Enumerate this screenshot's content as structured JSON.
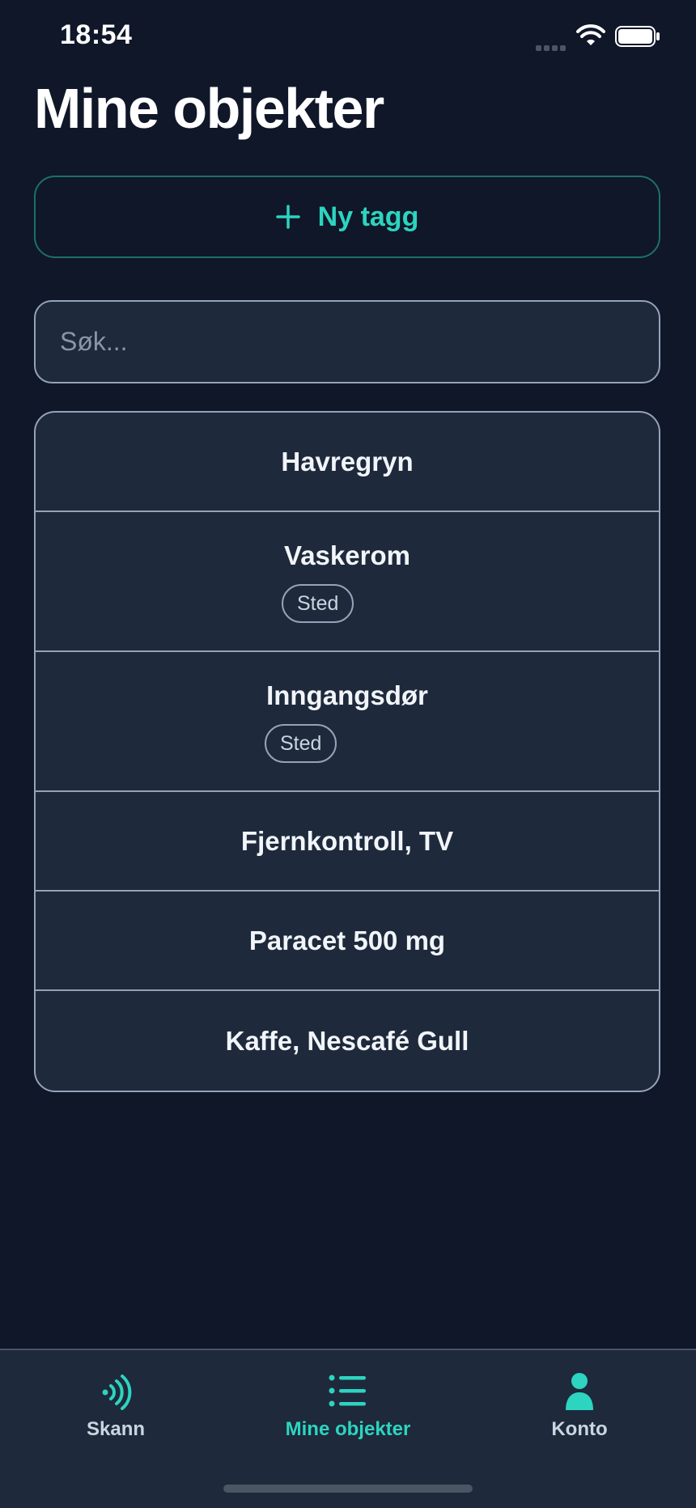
{
  "status_bar": {
    "time": "18:54"
  },
  "header": {
    "title": "Mine objekter"
  },
  "actions": {
    "new_tag_label": "Ny tagg"
  },
  "search": {
    "placeholder": "Søk...",
    "value": ""
  },
  "objects": [
    {
      "name": "Havregryn",
      "badge": null
    },
    {
      "name": "Vaskerom",
      "badge": "Sted"
    },
    {
      "name": "Inngangsdør",
      "badge": "Sted"
    },
    {
      "name": "Fjernkontroll, TV",
      "badge": null
    },
    {
      "name": "Paracet 500 mg",
      "badge": null
    },
    {
      "name": "Kaffe, Nescafé Gull",
      "badge": null
    }
  ],
  "tab_bar": {
    "tabs": [
      {
        "label": "Skann",
        "icon": "nfc-scan-icon",
        "active": false
      },
      {
        "label": "Mine objekter",
        "icon": "list-icon",
        "active": true
      },
      {
        "label": "Konto",
        "icon": "person-icon",
        "active": false
      }
    ]
  },
  "colors": {
    "background": "#0f1729",
    "surface": "#1e293b",
    "accent": "#2dd4bf",
    "border": "#94a3b8"
  }
}
